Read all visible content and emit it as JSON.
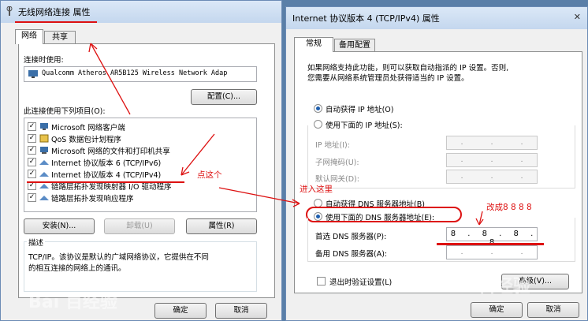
{
  "left_window": {
    "title": "无线网络连接 属性",
    "tabs": [
      "网络",
      "共享"
    ],
    "connect_using_label": "连接时使用:",
    "adapter_name": "Qualcomm Atheros AR5B125 Wireless Network Adap",
    "configure_button": "配置(C)...",
    "items_label": "此连接使用下列项目(O):",
    "items": [
      {
        "label": "Microsoft 网络客户端",
        "checked": true,
        "icon": "network-client-icon"
      },
      {
        "label": "QoS 数据包计划程序",
        "checked": true,
        "icon": "qos-icon"
      },
      {
        "label": "Microsoft 网络的文件和打印机共享",
        "checked": true,
        "icon": "file-printer-share-icon"
      },
      {
        "label": "Internet 协议版本 6 (TCP/IPv6)",
        "checked": true,
        "icon": "protocol-icon"
      },
      {
        "label": "Internet 协议版本 4 (TCP/IPv4)",
        "checked": true,
        "icon": "protocol-icon"
      },
      {
        "label": "链路层拓扑发现映射器 I/O 驱动程序",
        "checked": true,
        "icon": "protocol-icon"
      },
      {
        "label": "链路层拓扑发现响应程序",
        "checked": true,
        "icon": "protocol-icon"
      }
    ],
    "install_button": "安装(N)...",
    "uninstall_button": "卸载(U)",
    "properties_button": "属性(R)",
    "description_label": "描述",
    "description_text_line1": "TCP/IP。该协议是默认的广域网络协议，它提供在不同",
    "description_text_line2": "的相互连接的网络上的通讯。",
    "ok_button": "确定",
    "cancel_button": "取消"
  },
  "right_window": {
    "title": "Internet 协议版本 4 (TCP/IPv4) 属性",
    "tabs": [
      "常规",
      "备用配置"
    ],
    "intro_line1": "如果网络支持此功能，则可以获取自动指派的 IP 设置。否则,",
    "intro_line2": "您需要从网络系统管理员处获得适当的 IP 设置。",
    "auto_ip_radio": "自动获得 IP 地址(O)",
    "manual_ip_radio": "使用下面的 IP 地址(S):",
    "ip_address_label": "IP 地址(I):",
    "subnet_mask_label": "子网掩码(U):",
    "default_gateway_label": "默认网关(D):",
    "auto_dns_radio": "自动获得 DNS 服务器地址(B)",
    "manual_dns_radio": "使用下面的 DNS 服务器地址(E):",
    "preferred_dns_label": "首选 DNS 服务器(P):",
    "preferred_dns_value": "8 . 8 . 8 . 8",
    "alternate_dns_label": "备用 DNS 服务器(A):",
    "validate_on_exit_checkbox": "退出时验证设置(L)",
    "advanced_button": "高级(V)...",
    "ok_button": "确定",
    "cancel_button": "取消",
    "ip_dot": "."
  },
  "annotations": {
    "click_here": "点这个",
    "enter_here": "进入这里",
    "change_to": "改成8 8 8 8"
  },
  "watermark": "Bai 百经验",
  "colors": {
    "annotation_red": "#dd1111",
    "radio_selected": "#1f5fae"
  }
}
